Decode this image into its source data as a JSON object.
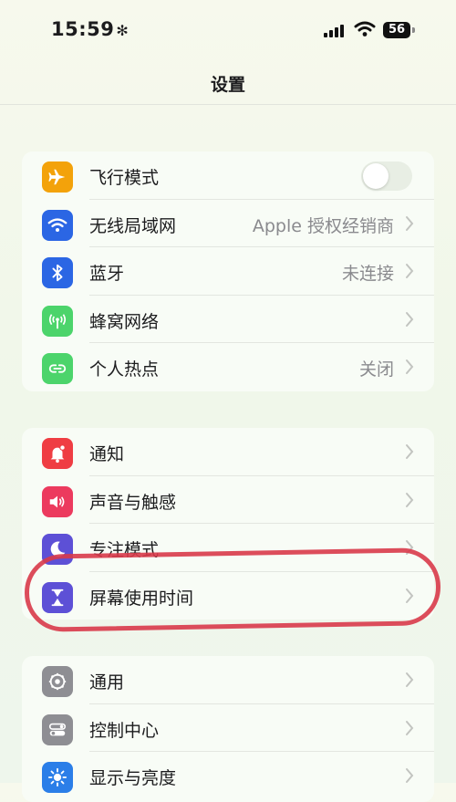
{
  "status": {
    "time": "15:59",
    "time_icon": "✻",
    "battery": "56"
  },
  "nav": {
    "title": "设置"
  },
  "groups": [
    {
      "items": [
        {
          "label": "飞行模式",
          "icon": "airplane-icon",
          "color": "#f3a20a",
          "value": "",
          "toggle": false
        },
        {
          "label": "无线局域网",
          "icon": "wifi-icon",
          "color": "#2b66e4",
          "value": "Apple 授权经销商"
        },
        {
          "label": "蓝牙",
          "icon": "bluetooth-icon",
          "color": "#2b66e4",
          "value": "未连接"
        },
        {
          "label": "蜂窝网络",
          "icon": "cellular-icon",
          "color": "#4cd46b",
          "value": ""
        },
        {
          "label": "个人热点",
          "icon": "hotspot-icon",
          "color": "#4cd46b",
          "value": "关闭"
        }
      ]
    },
    {
      "items": [
        {
          "label": "通知",
          "icon": "notification-bell-icon",
          "color": "#ef3d43",
          "value": ""
        },
        {
          "label": "声音与触感",
          "icon": "speaker-icon",
          "color": "#ec3a5e",
          "value": ""
        },
        {
          "label": "专注模式",
          "icon": "moon-icon",
          "color": "#5d50d6",
          "value": ""
        },
        {
          "label": "屏幕使用时间",
          "icon": "hourglass-icon",
          "color": "#5d50d6",
          "value": ""
        }
      ]
    },
    {
      "items": [
        {
          "label": "通用",
          "icon": "gear-icon",
          "color": "#8e8e93",
          "value": ""
        },
        {
          "label": "控制中心",
          "icon": "switches-icon",
          "color": "#8e8e93",
          "value": ""
        },
        {
          "label": "显示与亮度",
          "icon": "sun-icon",
          "color": "#2b7ee8",
          "value": ""
        }
      ]
    }
  ],
  "annotation": {
    "color": "#d83a4a",
    "target": "屏幕使用时间"
  }
}
